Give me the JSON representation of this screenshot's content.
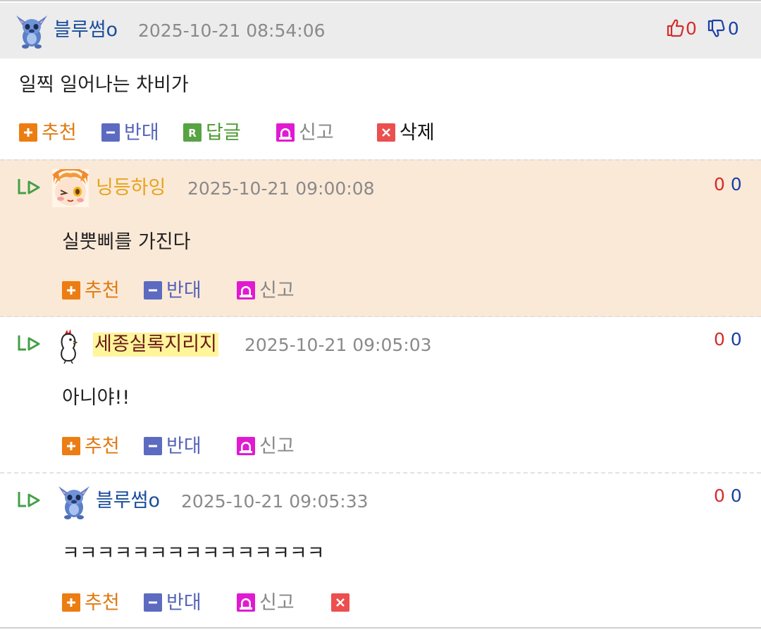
{
  "comments": [
    {
      "author": "블루썸o",
      "timestamp": "2025-10-21 08:54:06",
      "text": "일찍 일어나는 차비가",
      "up": "0",
      "down": "0",
      "is_reply": false,
      "actions": {
        "recommend": "추천",
        "oppose": "반대",
        "reply": "답글",
        "report": "신고",
        "delete": "삭제"
      }
    },
    {
      "author": "닝등하잉",
      "timestamp": "2025-10-21 09:00:08",
      "text": "실뿟삐를 가진다",
      "up": "0",
      "down": "0",
      "is_reply": true,
      "actions": {
        "recommend": "추천",
        "oppose": "반대",
        "report": "신고"
      }
    },
    {
      "author": "세종실록지리지",
      "timestamp": "2025-10-21 09:05:03",
      "text": "아니야!!",
      "up": "0",
      "down": "0",
      "is_reply": true,
      "actions": {
        "recommend": "추천",
        "oppose": "반대",
        "report": "신고"
      }
    },
    {
      "author": "블루썸o",
      "timestamp": "2025-10-21 09:05:33",
      "text": "ㅋㅋㅋㅋㅋㅋㅋㅋㅋㅋㅋㅋㅋㅋㅋ",
      "up": "0",
      "down": "0",
      "is_reply": true,
      "actions": {
        "recommend": "추천",
        "oppose": "반대",
        "report": "신고"
      }
    }
  ],
  "colors": {
    "highlight_row": "#fbe9d7",
    "author_name": "#1a4d9c",
    "up_vote": "#d52b2b",
    "down_vote": "#1a3fa6",
    "recommend": "#ec7d12",
    "oppose": "#5c6bc0",
    "reply": "#58a343",
    "report": "#e11ad2",
    "delete": "#ec4f4f"
  },
  "icons": [
    "thumbs-up-icon",
    "thumbs-down-icon",
    "reply-arrow-icon",
    "plus-icon",
    "minus-icon",
    "reply-r-icon",
    "siren-icon",
    "close-x-icon",
    "avatar-stitch",
    "avatar-anime-girl",
    "avatar-chick"
  ]
}
